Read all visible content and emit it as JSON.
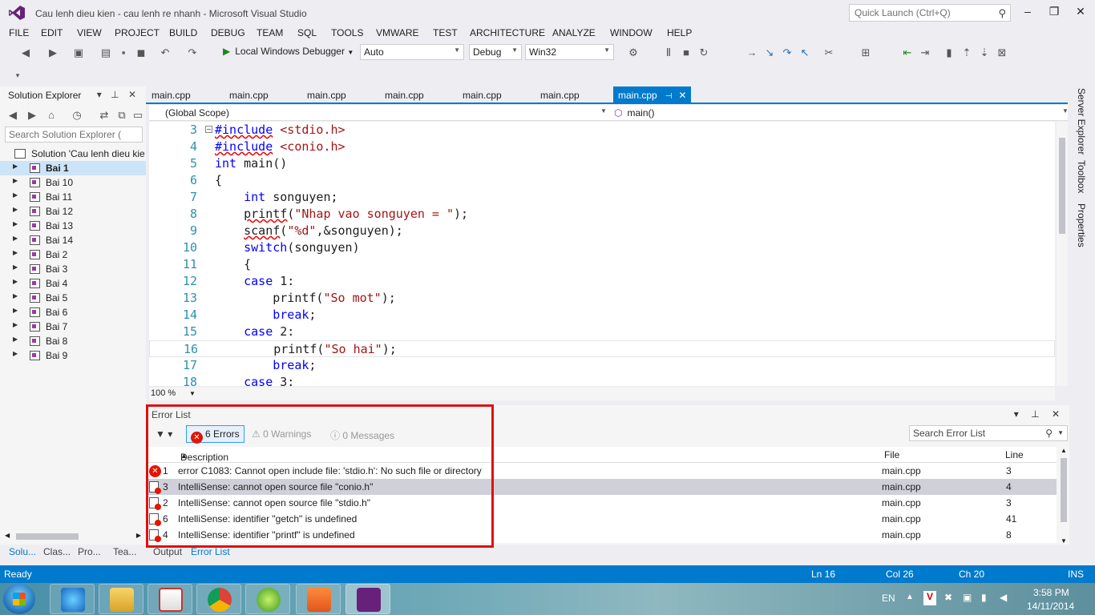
{
  "window": {
    "title": "Cau lenh dieu kien - cau lenh re nhanh - Microsoft Visual Studio",
    "quick_launch_placeholder": "Quick Launch (Ctrl+Q)"
  },
  "menu": [
    "FILE",
    "EDIT",
    "VIEW",
    "PROJECT",
    "BUILD",
    "DEBUG",
    "TEAM",
    "SQL",
    "TOOLS",
    "VMWARE",
    "TEST",
    "ARCHITECTURE",
    "ANALYZE",
    "WINDOW",
    "HELP"
  ],
  "toolbar": {
    "run_label": "Local Windows Debugger",
    "combo_auto": "Auto",
    "combo_config": "Debug",
    "combo_platform": "Win32"
  },
  "solution_explorer": {
    "title": "Solution Explorer",
    "search_placeholder": "Search Solution Explorer (",
    "solution_label": "Solution 'Cau lenh dieu kie",
    "projects": [
      "Bai 1",
      "Bai 10",
      "Bai 11",
      "Bai 12",
      "Bai 13",
      "Bai 14",
      "Bai 2",
      "Bai 3",
      "Bai 4",
      "Bai 5",
      "Bai 6",
      "Bai 7",
      "Bai 8",
      "Bai 9"
    ]
  },
  "bottom_left_tabs": [
    "Solu...",
    "Clas...",
    "Pro...",
    "Tea..."
  ],
  "bottom_tabs": {
    "output": "Output",
    "error_list": "Error List"
  },
  "doc_tabs": [
    "main.cpp",
    "main.cpp",
    "main.cpp",
    "main.cpp",
    "main.cpp",
    "main.cpp",
    "main.cpp"
  ],
  "nav": {
    "scope": "(Global Scope)",
    "member": "main()"
  },
  "editor": {
    "zoom": "100 %",
    "line_numbers": [
      "3",
      "4",
      "5",
      "6",
      "7",
      "8",
      "9",
      "10",
      "11",
      "12",
      "13",
      "14",
      "15",
      "16",
      "17",
      "18"
    ]
  },
  "error_list": {
    "title": "Error List",
    "errors_btn": "6 Errors",
    "warnings_btn": "0 Warnings",
    "messages_btn": "0 Messages",
    "search_placeholder": "Search Error List",
    "col_description": "Description",
    "col_file": "File",
    "col_line": "Line",
    "rows": [
      {
        "num": "1",
        "desc": "error C1083: Cannot open include file: 'stdio.h': No such file or directory",
        "file": "main.cpp",
        "line": "3"
      },
      {
        "num": "3",
        "desc": "IntelliSense: cannot open source file \"conio.h\"",
        "file": "main.cpp",
        "line": "4"
      },
      {
        "num": "2",
        "desc": "IntelliSense: cannot open source file \"stdio.h\"",
        "file": "main.cpp",
        "line": "3"
      },
      {
        "num": "6",
        "desc": "IntelliSense: identifier \"getch\" is undefined",
        "file": "main.cpp",
        "line": "41"
      },
      {
        "num": "4",
        "desc": "IntelliSense: identifier \"printf\" is undefined",
        "file": "main.cpp",
        "line": "8"
      }
    ]
  },
  "right_tabs": [
    "Server Explorer",
    "Toolbox",
    "Properties"
  ],
  "status": {
    "ready": "Ready",
    "ln": "Ln 16",
    "col": "Col 26",
    "ch": "Ch 20",
    "ins": "INS"
  },
  "taskbar": {
    "lang": "EN",
    "time": "3:58 PM",
    "date": "14/11/2014"
  },
  "colors": {
    "accent": "#007acc",
    "error": "#e51400",
    "highlight_box": "#e01010"
  }
}
